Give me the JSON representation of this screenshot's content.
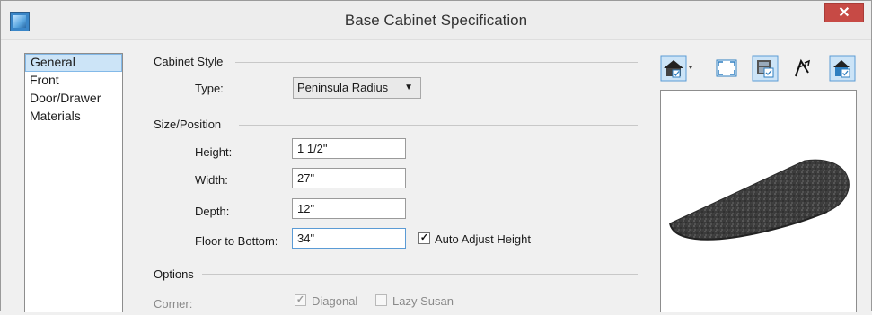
{
  "window": {
    "title": "Base Cabinet Specification",
    "close_label": "✕"
  },
  "sidebar": {
    "items": [
      {
        "label": "General"
      },
      {
        "label": "Front"
      },
      {
        "label": "Door/Drawer"
      },
      {
        "label": "Materials"
      }
    ]
  },
  "cabinet_style": {
    "section_label": "Cabinet Style",
    "type_label": "Type:",
    "type_value": "Peninsula Radius"
  },
  "size_position": {
    "section_label": "Size/Position",
    "height_label": "Height:",
    "height_value": "1 1/2\"",
    "width_label": "Width:",
    "width_value": "27\"",
    "depth_label": "Depth:",
    "depth_value": "12\"",
    "floor_label": "Floor to Bottom:",
    "floor_value": "34\"",
    "auto_adjust_label": "Auto Adjust Height",
    "auto_adjust_checked": true
  },
  "options": {
    "section_label": "Options",
    "corner_label": "Corner:",
    "diagonal_label": "Diagonal",
    "diagonal_checked": true,
    "lazy_susan_label": "Lazy Susan",
    "lazy_susan_checked": false
  },
  "toolbar": {
    "icons": [
      "view-camera-icon",
      "fit-to-window-icon",
      "show-cabinet-icon",
      "orbit-icon",
      "select-view-icon"
    ]
  },
  "colors": {
    "selection": "#cce4f7",
    "close_button": "#c74a45",
    "accent": "#2f7fc0"
  }
}
